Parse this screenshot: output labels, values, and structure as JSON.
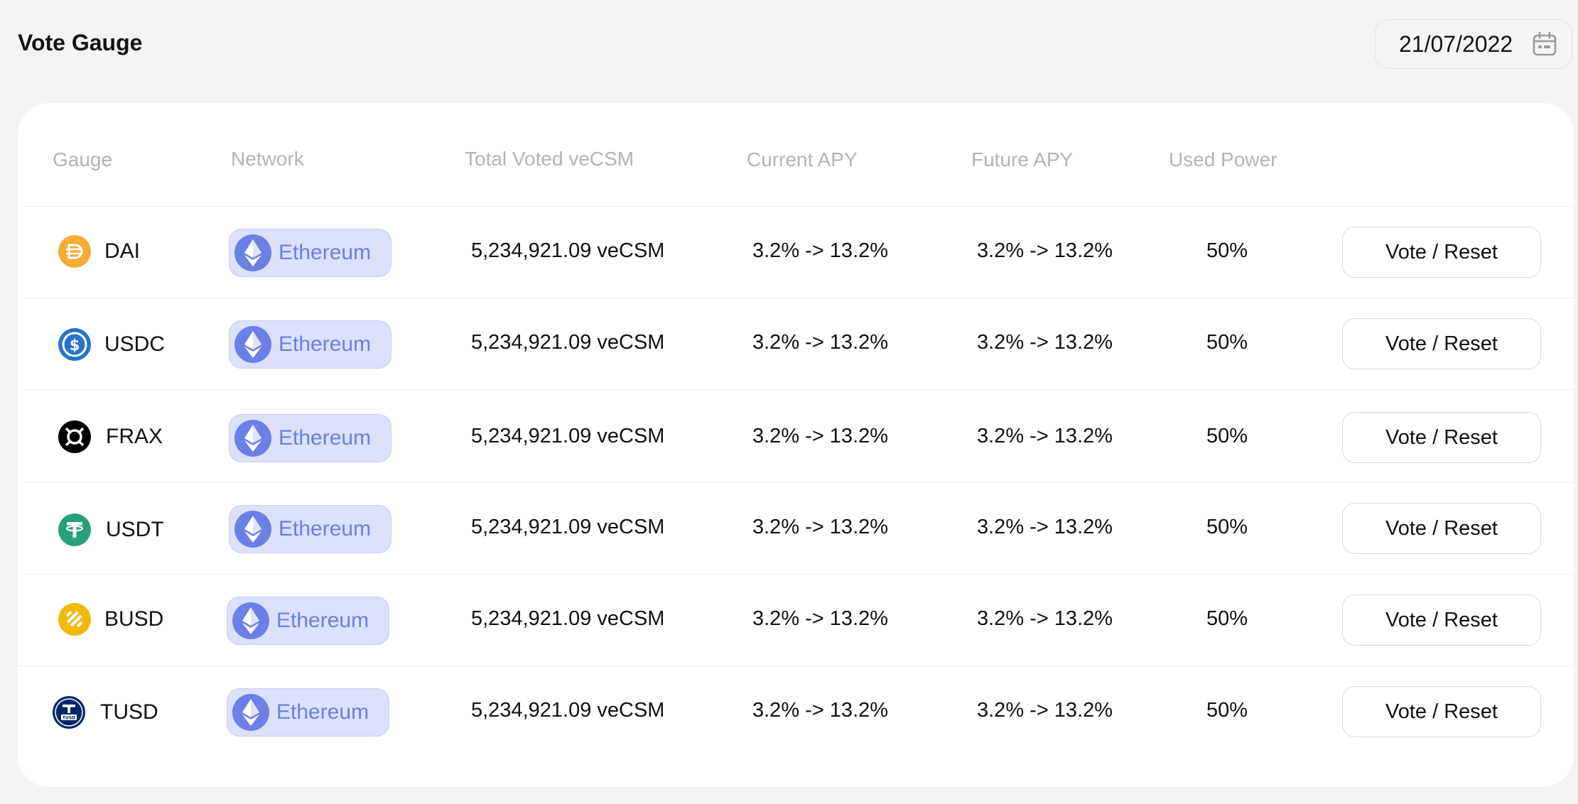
{
  "page": {
    "title": "Vote Gauge"
  },
  "date_picker": {
    "value": "21/07/2022",
    "icon": "calendar-icon"
  },
  "table": {
    "columns": {
      "gauge": "Gauge",
      "network": "Network",
      "total_voted": "Total Voted veCSM",
      "current_apy": "Current APY",
      "future_apy": "Future APY",
      "used_power": "Used Power"
    },
    "rows": [
      {
        "token": "DAI",
        "network": "Ethereum",
        "total_voted": "5,234,921.09 veCSM",
        "current_apy": "3.2% -> 13.2%",
        "future_apy": "3.2% -> 13.2%",
        "used_power": "50%",
        "action": "Vote / Reset"
      },
      {
        "token": "USDC",
        "network": "Ethereum",
        "total_voted": "5,234,921.09 veCSM",
        "current_apy": "3.2% -> 13.2%",
        "future_apy": "3.2% -> 13.2%",
        "used_power": "50%",
        "action": "Vote / Reset"
      },
      {
        "token": "FRAX",
        "network": "Ethereum",
        "total_voted": "5,234,921.09 veCSM",
        "current_apy": "3.2% -> 13.2%",
        "future_apy": "3.2% -> 13.2%",
        "used_power": "50%",
        "action": "Vote / Reset"
      },
      {
        "token": "USDT",
        "network": "Ethereum",
        "total_voted": "5,234,921.09 veCSM",
        "current_apy": "3.2% -> 13.2%",
        "future_apy": "3.2% -> 13.2%",
        "used_power": "50%",
        "action": "Vote / Reset"
      },
      {
        "token": "BUSD",
        "network": "Ethereum",
        "total_voted": "5,234,921.09 veCSM",
        "current_apy": "3.2% -> 13.2%",
        "future_apy": "3.2% -> 13.2%",
        "used_power": "50%",
        "action": "Vote / Reset"
      },
      {
        "token": "TUSD",
        "network": "Ethereum",
        "total_voted": "5,234,921.09 veCSM",
        "current_apy": "3.2% -> 13.2%",
        "future_apy": "3.2% -> 13.2%",
        "used_power": "50%",
        "action": "Vote / Reset"
      }
    ]
  },
  "icons": {
    "DAI": {
      "name": "dai-icon",
      "color": "#f5ac37"
    },
    "USDC": {
      "name": "usdc-icon",
      "color": "#2775ca"
    },
    "FRAX": {
      "name": "frax-icon",
      "color": "#000000"
    },
    "USDT": {
      "name": "usdt-icon",
      "color": "#26a17b"
    },
    "BUSD": {
      "name": "busd-icon",
      "color": "#f0b90b"
    },
    "TUSD": {
      "name": "tusd-icon",
      "color": "#002868"
    },
    "network": {
      "name": "ethereum-icon",
      "color": "#6a80e6"
    }
  },
  "colors": {
    "badge_bg": "#dde0fb",
    "badge_text": "#6b80e4",
    "header_text": "#b3b3b3"
  }
}
